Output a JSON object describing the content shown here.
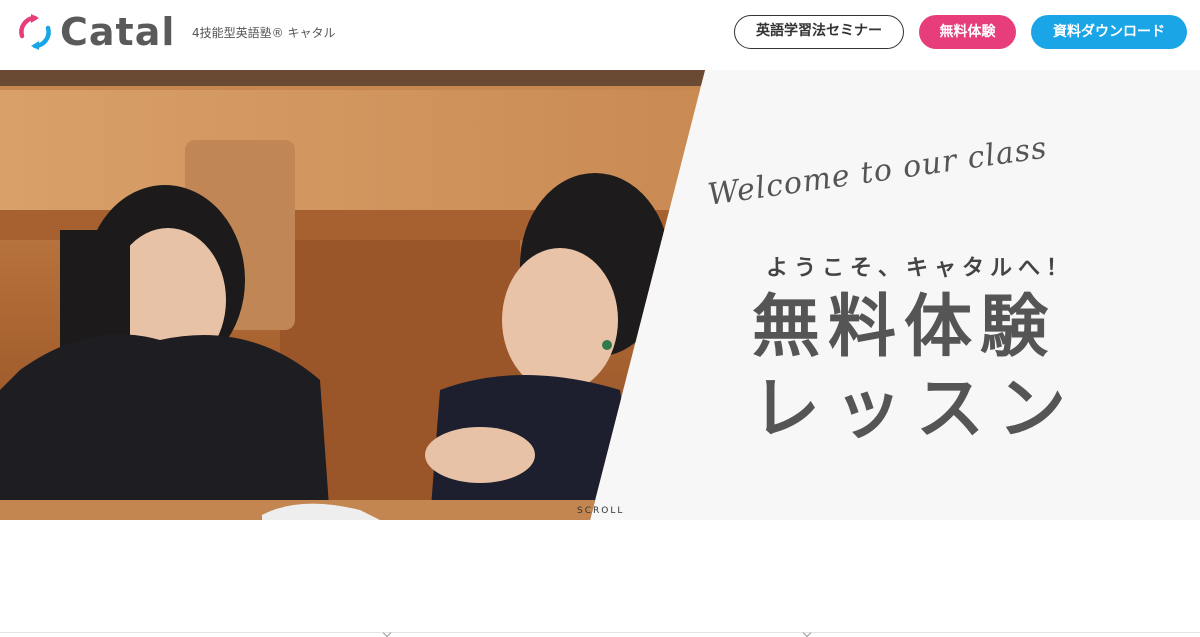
{
  "header": {
    "logo_text": "Catal",
    "tagline": "4技能型英語塾® キャタル",
    "buttons": {
      "seminar": "英語学習法セミナー",
      "trial": "無料体験",
      "download": "資料ダウンロード"
    }
  },
  "hero": {
    "welcome_script": "Welcome to our class",
    "subtitle": "ようこそ、キャタルへ！",
    "title_line1": "無料体験",
    "title_line2": "レッスン",
    "scroll_label": "SCROLL"
  },
  "colors": {
    "pink": "#e73d7b",
    "blue": "#1aa5e6",
    "text_dark": "#555555"
  }
}
